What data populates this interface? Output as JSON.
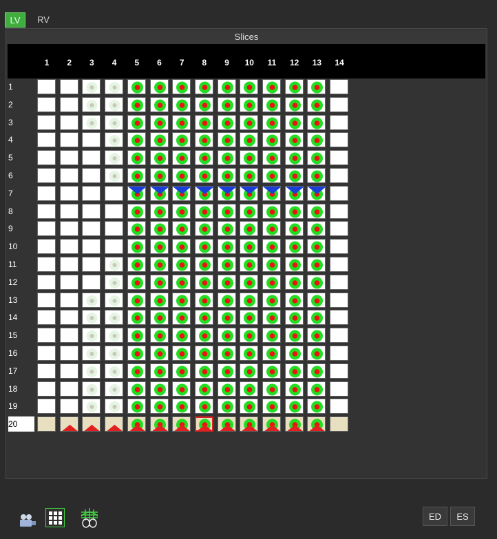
{
  "tabs": {
    "lv": "LV",
    "rv": "RV"
  },
  "panel": {
    "title": "Slices"
  },
  "columns": [
    "1",
    "2",
    "3",
    "4",
    "5",
    "6",
    "7",
    "8",
    "9",
    "10",
    "11",
    "12",
    "13",
    "14"
  ],
  "rows": [
    "1",
    "2",
    "3",
    "4",
    "5",
    "6",
    "7",
    "8",
    "9",
    "10",
    "11",
    "12",
    "13",
    "14",
    "15",
    "16",
    "17",
    "18",
    "19",
    "20"
  ],
  "grid": {
    "faint_columns_by_row": {
      "1": [
        3,
        4
      ],
      "2": [
        3,
        4
      ],
      "3": [
        3,
        4
      ],
      "4": [
        4
      ],
      "5": [
        4
      ],
      "6": [
        4
      ],
      "7": [],
      "8": [],
      "9": [],
      "10": [],
      "11": [
        4
      ],
      "12": [
        4
      ],
      "13": [
        3,
        4
      ],
      "14": [
        3,
        4
      ],
      "15": [
        3,
        4
      ],
      "16": [
        3,
        4
      ],
      "17": [
        3,
        4
      ],
      "18": [
        3,
        4
      ],
      "19": [
        3,
        4
      ],
      "20": []
    },
    "contour_columns": [
      5,
      6,
      7,
      8,
      9,
      10,
      11,
      12,
      13
    ],
    "es_row": "7",
    "ed_row": "20",
    "ed_marker_columns": [
      2,
      3,
      4,
      5,
      6,
      7,
      8,
      9,
      10,
      11,
      12,
      13
    ],
    "selected": {
      "row": "20",
      "column": "8"
    },
    "active_row": "20"
  },
  "colors": {
    "contour_green": "#22dd22",
    "contour_center": "#ee1111",
    "es_marker": "#1a3fd6",
    "ed_marker": "#e22020",
    "lv_tab": "#3fae3f"
  },
  "buttons": {
    "ed": "ED",
    "es": "ES"
  },
  "icons": [
    "movie-camera-icon",
    "matrix-view-icon",
    "mesh-3d-icon"
  ]
}
